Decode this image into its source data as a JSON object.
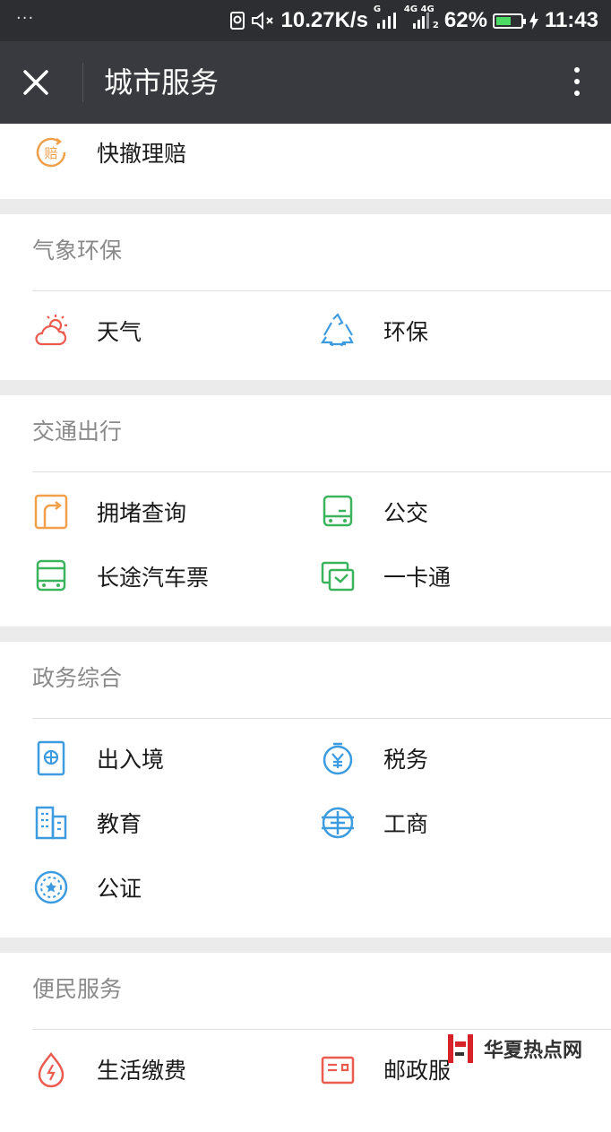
{
  "status_bar": {
    "dots": "···",
    "speed": "10.27K/s",
    "sim1_label": "G",
    "sim2_label": "4G 4G",
    "sim2_index": "2",
    "battery_percent": "62%",
    "battery_level": 0.62,
    "time": "11:43"
  },
  "title_bar": {
    "title": "城市服务"
  },
  "top_item": {
    "label": "快撤理赔",
    "icon_glyph": "赔"
  },
  "sections": {
    "weather": {
      "title": "气象环保",
      "items": [
        "天气",
        "环保"
      ]
    },
    "traffic": {
      "title": "交通出行",
      "items": [
        "拥堵查询",
        "公交",
        "长途汽车票",
        "一卡通"
      ]
    },
    "government": {
      "title": "政务综合",
      "items": [
        "出入境",
        "税务",
        "教育",
        "工商",
        "公证"
      ]
    },
    "convenience": {
      "title": "便民服务",
      "items": [
        "生活缴费",
        "邮政服"
      ]
    }
  },
  "watermark": {
    "text": "华夏热点网"
  },
  "colors": {
    "status_bg": "#2d2e31",
    "title_bg": "#393a3f",
    "orange": "#f0a04b",
    "green": "#3bb35d",
    "blue": "#3d9be0",
    "red": "#ec5b4f",
    "gap": "#ebebeb"
  }
}
